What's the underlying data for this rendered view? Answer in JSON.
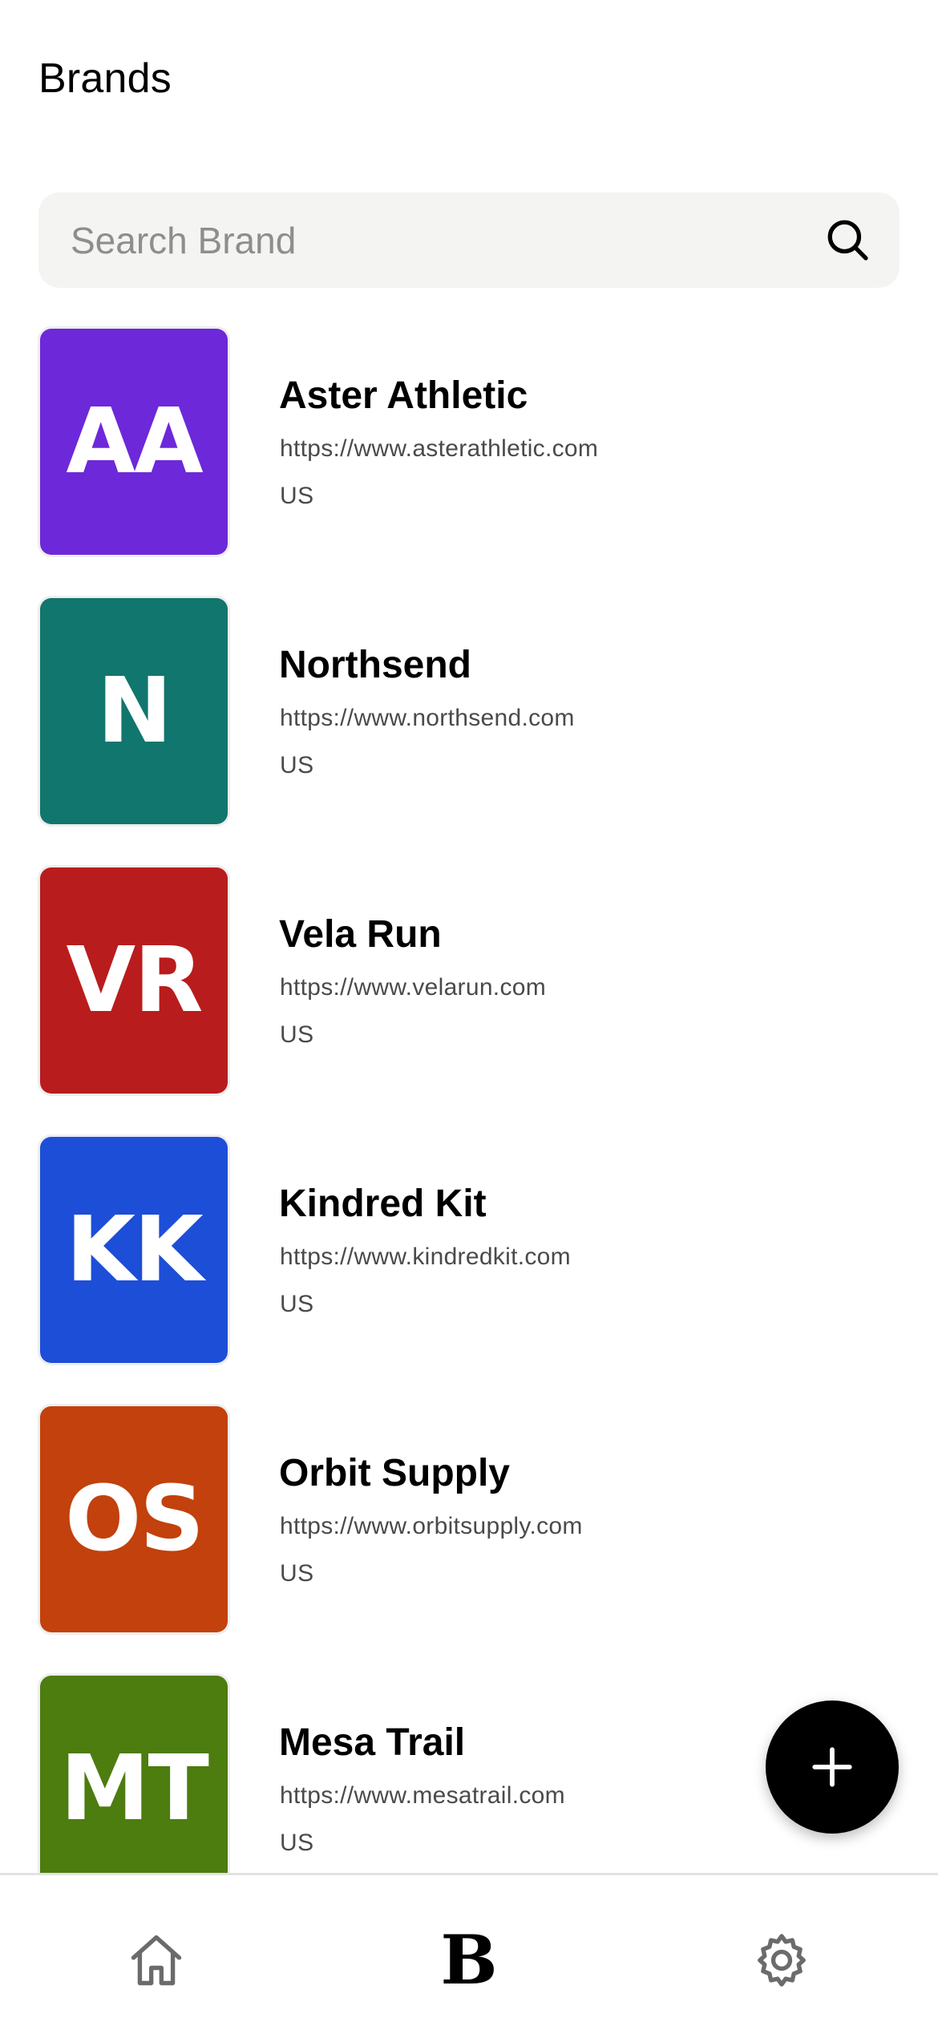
{
  "header": {
    "title": "Brands"
  },
  "search": {
    "placeholder": "Search Brand",
    "value": "",
    "icon": "search-icon"
  },
  "brands": [
    {
      "initials": "AA",
      "name": "Aster Athletic",
      "url": "https://www.asterathletic.com",
      "country": "US",
      "color": "#6d28d9"
    },
    {
      "initials": "N",
      "name": "Northsend",
      "url": "https://www.northsend.com",
      "country": "US",
      "color": "#11766d"
    },
    {
      "initials": "VR",
      "name": "Vela Run",
      "url": "https://www.velarun.com",
      "country": "US",
      "color": "#b91c1c"
    },
    {
      "initials": "KK",
      "name": "Kindred Kit",
      "url": "https://www.kindredkit.com",
      "country": "US",
      "color": "#1d4ed8"
    },
    {
      "initials": "OS",
      "name": "Orbit Supply",
      "url": "https://www.orbitsupply.com",
      "country": "US",
      "color": "#c2410c"
    },
    {
      "initials": "MT",
      "name": "Mesa Trail",
      "url": "https://www.mesatrail.com",
      "country": "US",
      "color": "#4d7c0f"
    }
  ],
  "fab": {
    "icon": "plus-icon"
  },
  "tab_bar": {
    "tabs": [
      {
        "icon": "home-icon",
        "active": false
      },
      {
        "icon": "brand-b-icon",
        "glyph": "B",
        "active": true
      },
      {
        "icon": "gear-icon",
        "active": false
      }
    ]
  },
  "colors": {
    "background": "#ffffff",
    "search_background": "#f4f4f2",
    "text_primary": "#000000",
    "text_secondary": "#4a4a4a",
    "icon_inactive": "#6b6b6b",
    "fab_background": "#000000"
  }
}
